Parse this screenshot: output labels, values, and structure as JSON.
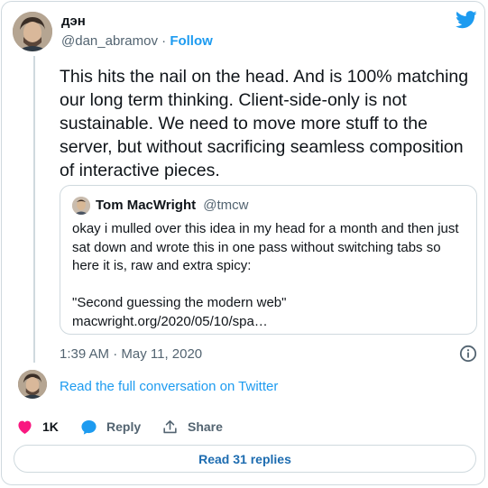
{
  "author": {
    "display_name": "дэн",
    "handle": "@dan_abramov",
    "separator": "·",
    "follow_label": "Follow"
  },
  "tweet": {
    "text": "This hits the nail on the head. And is 100% matching our long term thinking. Client-side-only is not sustainable. We need to move more stuff to the server, but without sacrificing seamless composition of interactive pieces.",
    "timestamp": "1:39 AM · May 11, 2020"
  },
  "quote": {
    "name": "Tom MacWright",
    "handle": "@tmcw",
    "text_line1": "okay i mulled over this idea in my head for a month and then just sat down and wrote this in one pass without switching tabs so here it is, raw and extra spicy:",
    "text_line2": "\"Second guessing the modern web\"",
    "text_line3": "macwright.org/2020/05/10/spa…"
  },
  "read_conversation_label": "Read the full conversation on Twitter",
  "actions": {
    "likes_count": "1K",
    "reply_label": "Reply",
    "share_label": "Share"
  },
  "replies_button_label": "Read 31 replies",
  "colors": {
    "accent": "#1d9bf0",
    "like": "#f91880",
    "secondary_text": "#536471",
    "border": "#cfd9de"
  },
  "icons": {
    "logo": "twitter-bird-icon",
    "info": "info-icon",
    "like": "heart-icon",
    "reply": "speech-bubble-icon",
    "share": "share-upload-icon"
  }
}
